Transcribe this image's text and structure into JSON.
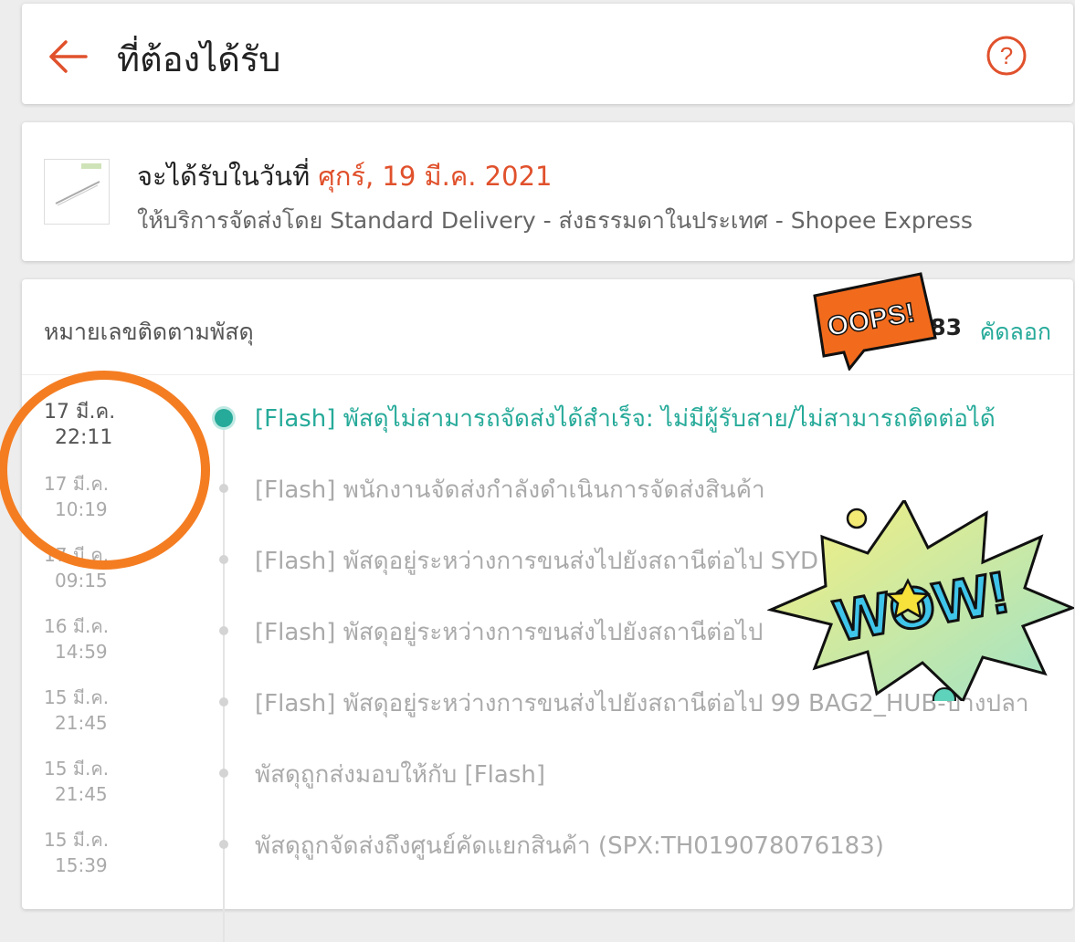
{
  "header": {
    "title": "ที่ต้องได้รับ"
  },
  "delivery": {
    "prefix": "จะได้รับในวันที่ ",
    "date": "ศุกร์, 19 มี.ค. 2021",
    "service": "ให้บริการจัดส่งโดย Standard Delivery - ส่งธรรมดาในประเทศ - Shopee Express"
  },
  "tracking": {
    "label": "หมายเลขติดตามพัสดุ",
    "number_visible": "TH01 83",
    "copy_label": "คัดลอก"
  },
  "events": [
    {
      "date": "17 มี.ค.",
      "time": "22:11",
      "text": "[Flash] พัสดุไม่สามารถจัดส่งได้สำเร็จ: ไม่มีผู้รับสาย/ไม่สามารถติดต่อได้",
      "active": true
    },
    {
      "date": "17 มี.ค.",
      "time": "10:19",
      "text": "[Flash] พนักงานจัดส่งกำลังดำเนินการจัดส่งสินค้า",
      "active": false
    },
    {
      "date": "17 มี.ค.",
      "time": "09:15",
      "text": "[Flash] พัสดุอยู่ระหว่างการขนส่งไปยังสถานีต่อไป  SYD",
      "active": false
    },
    {
      "date": "16 มี.ค.",
      "time": "14:59",
      "text": "[Flash] พัสดุอยู่ระหว่างการขนส่งไปยังสถานีต่อไป",
      "active": false
    },
    {
      "date": "15 มี.ค.",
      "time": "21:45",
      "text": "[Flash] พัสดุอยู่ระหว่างการขนส่งไปยังสถานีต่อไป  99 BAG2_HUB-บางปลา",
      "active": false
    },
    {
      "date": "15 มี.ค.",
      "time": "21:45",
      "text": "พัสดุถูกส่งมอบให้กับ [Flash]",
      "active": false
    },
    {
      "date": "15 มี.ค.",
      "time": "15:39",
      "text": "พัสดุถูกจัดส่งถึงศูนย์คัดแยกสินค้า (SPX:TH019078076183)",
      "active": false
    }
  ],
  "stickers": {
    "oops": "OOPS!",
    "wow": "WOW!"
  },
  "colors": {
    "accent": "#e0512c",
    "teal": "#26aa99",
    "highlight": "#f47d22"
  }
}
